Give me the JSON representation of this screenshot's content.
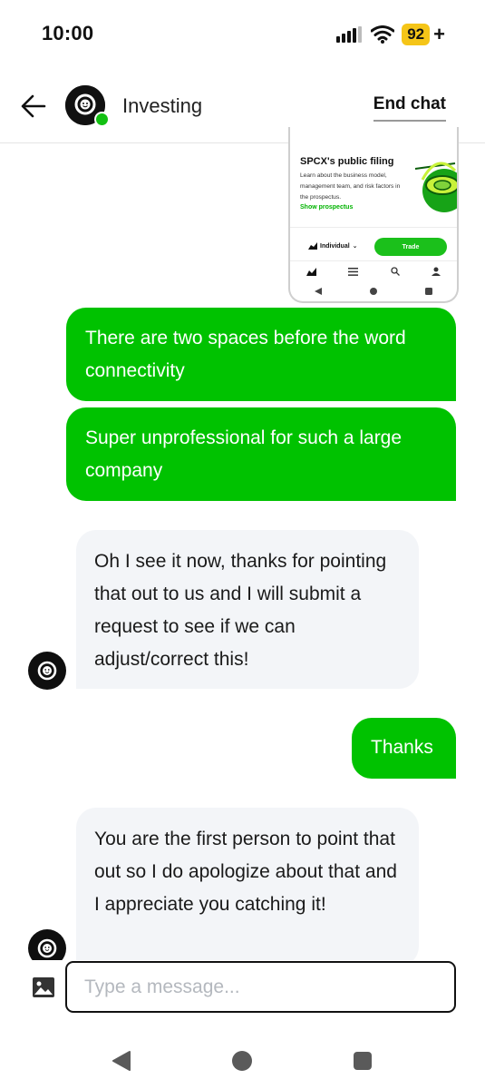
{
  "status_bar": {
    "time": "10:00",
    "battery": "92",
    "battery_charging": "+"
  },
  "header": {
    "title": "Investing",
    "end_chat_label": "End chat"
  },
  "shared_screenshot": {
    "title": "SPCX's public filing",
    "description": "Learn about the business model, management team, and risk factors in the prospectus.",
    "link_label": "Show prospectus",
    "account_selector": "Individual",
    "trade_button": "Trade",
    "nav_icons": [
      "chart-icon",
      "list-icon",
      "search-icon",
      "person-icon"
    ]
  },
  "messages": [
    {
      "from": "user",
      "text": "There are two spaces before the word connectivity"
    },
    {
      "from": "user",
      "text": "Super unprofessional for such a large company"
    },
    {
      "from": "agent",
      "text": "Oh I see it now, thanks for pointing that out to us and I will submit a request to see if we can adjust/correct this!"
    },
    {
      "from": "user",
      "text": "Thanks"
    },
    {
      "from": "agent",
      "text": "You are the first person to point that out so I do apologize about that and I appreciate you catching it!"
    }
  ],
  "composer": {
    "placeholder": "Type a message..."
  },
  "colors": {
    "accent": "#00c200",
    "battery": "#f5c518",
    "agent_bubble": "#f3f5f8"
  }
}
